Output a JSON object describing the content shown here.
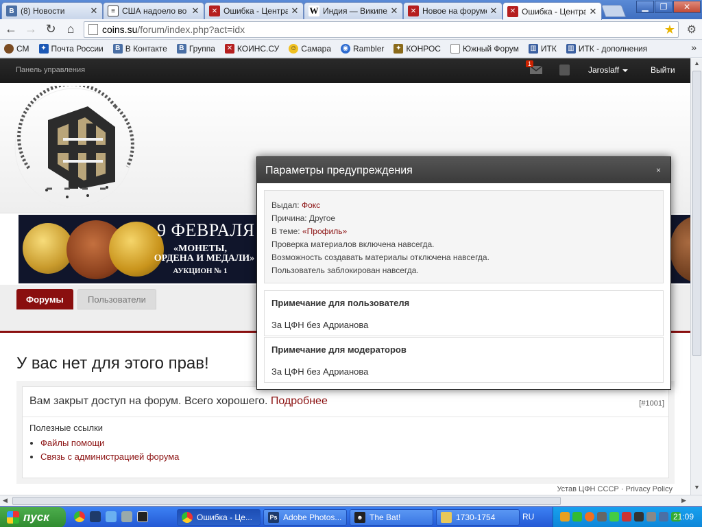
{
  "browser": {
    "tabs": [
      {
        "title": "(8) Новости",
        "icon": "vk-icon"
      },
      {
        "title": "США надоело во",
        "icon": "document-icon"
      },
      {
        "title": "Ошибка - Центра",
        "icon": "coins-forum-icon"
      },
      {
        "title": "Индия — Википед",
        "icon": "wikipedia-icon"
      },
      {
        "title": "Новое на форуме",
        "icon": "coins-forum-icon"
      },
      {
        "title": "Ошибка - Центра",
        "icon": "coins-forum-icon"
      }
    ],
    "url_host": "coins.su",
    "url_path": "/forum/index.php?act=idx",
    "bookmarks": [
      {
        "label": "СМ",
        "color": "#7a4b22"
      },
      {
        "label": "Почта России",
        "color": "#1c58b5"
      },
      {
        "label": "В Контакте",
        "color": "#4a6fa5"
      },
      {
        "label": "Группа",
        "color": "#4a6fa5"
      },
      {
        "label": "КОИНС.СУ",
        "color": "#b51f1f"
      },
      {
        "label": "Самара",
        "color": "#f0c020"
      },
      {
        "label": "Rambler",
        "color": "#2d6bd0"
      },
      {
        "label": "КОНРОС",
        "color": "#8a6a1a"
      },
      {
        "label": "Южный Форум",
        "color": "#ffffff"
      },
      {
        "label": "ИТК",
        "color": "#3a5fa0"
      },
      {
        "label": "ИТК - дополнения",
        "color": "#3a5fa0"
      }
    ],
    "more_bookmarks": "»"
  },
  "admin_bar": {
    "control_panel": "Панель управления",
    "mail_badge": "1",
    "username": "Jaroslaff",
    "logout": "Выйти"
  },
  "banner": {
    "date": "9 ФЕВРАЛЯ",
    "line1": "«МОНЕТЫ,",
    "line2": "ОРДЕНА И МЕДАЛИ»",
    "line3": "АУКЦИОН № 1"
  },
  "nav": {
    "forums": "Форумы",
    "users": "Пользователи"
  },
  "content": {
    "heading": "У вас нет для этого прав!",
    "message": "Вам закрыт доступ на форум. Всего хорошего.",
    "more_link": "Подробнее",
    "error_code": "[#1001]",
    "useful_links_title": "Полезные ссылки",
    "links": [
      "Файлы помощи",
      "Связь с администрацией форума"
    ]
  },
  "footer": {
    "rules": "Устав ЦФН СССР",
    "separator": "·",
    "privacy": "Privacy Policy"
  },
  "modal": {
    "title": "Параметры предупреждения",
    "close": "×",
    "issued_by_label": "Выдал:",
    "issued_by": "Фокс",
    "reason_label": "Причина:",
    "reason": "Другое",
    "topic_label": "В теме:",
    "topic": "«Профиль»",
    "line4": "Проверка материалов включена навсегда.",
    "line5": "Возможность создавать материалы отключена навсегда.",
    "line6": "Пользователь заблокирован навсегда.",
    "user_note_title": "Примечание для пользователя",
    "user_note": "За ЦФН без Адрианова",
    "mod_note_title": "Примечание для модераторов",
    "mod_note": "За ЦФН без Адрианова"
  },
  "taskbar": {
    "start": "пуск",
    "buttons": [
      {
        "label": "Ошибка - Це...",
        "icon": "chrome-icon"
      },
      {
        "label": "Adobe Photos...",
        "icon": "photoshop-icon"
      },
      {
        "label": "The Bat!",
        "icon": "thebat-icon"
      },
      {
        "label": "1730-1754",
        "icon": "folder-icon"
      }
    ],
    "lang": "RU",
    "clock": "21:09"
  },
  "colors": {
    "accent": "#8a0f0f",
    "admin_bar": "#1f1f1f"
  }
}
